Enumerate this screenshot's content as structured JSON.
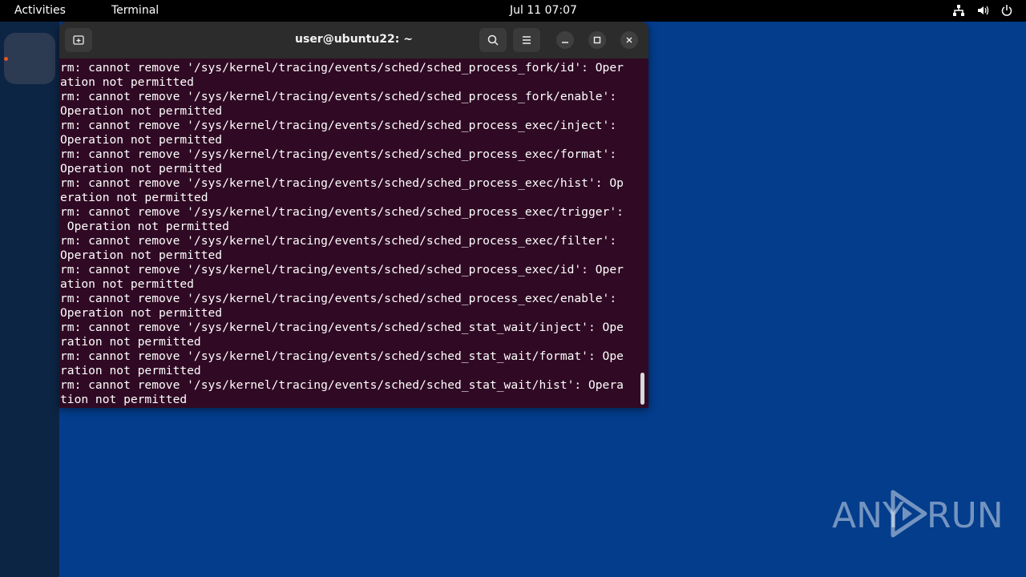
{
  "topbar": {
    "activities": "Activities",
    "app_name": "Terminal",
    "clock": "Jul 11  07:07",
    "tray_icons": [
      "network-icon",
      "volume-icon",
      "power-icon"
    ]
  },
  "dock": {
    "apps": [
      {
        "name": "terminal",
        "running": true
      }
    ],
    "running_indicator_color": "#e95420"
  },
  "window": {
    "title": "user@ubuntu22: ~",
    "background": "#300a24",
    "terminal_lines": [
      "rm: cannot remove '/sys/kernel/tracing/events/sched/sched_process_fork/id': Oper",
      "ation not permitted",
      "rm: cannot remove '/sys/kernel/tracing/events/sched/sched_process_fork/enable':",
      "Operation not permitted",
      "rm: cannot remove '/sys/kernel/tracing/events/sched/sched_process_exec/inject':",
      "Operation not permitted",
      "rm: cannot remove '/sys/kernel/tracing/events/sched/sched_process_exec/format':",
      "Operation not permitted",
      "rm: cannot remove '/sys/kernel/tracing/events/sched/sched_process_exec/hist': Op",
      "eration not permitted",
      "rm: cannot remove '/sys/kernel/tracing/events/sched/sched_process_exec/trigger':",
      " Operation not permitted",
      "rm: cannot remove '/sys/kernel/tracing/events/sched/sched_process_exec/filter':",
      "Operation not permitted",
      "rm: cannot remove '/sys/kernel/tracing/events/sched/sched_process_exec/id': Oper",
      "ation not permitted",
      "rm: cannot remove '/sys/kernel/tracing/events/sched/sched_process_exec/enable':",
      "Operation not permitted",
      "rm: cannot remove '/sys/kernel/tracing/events/sched/sched_stat_wait/inject': Ope",
      "ration not permitted",
      "rm: cannot remove '/sys/kernel/tracing/events/sched/sched_stat_wait/format': Ope",
      "ration not permitted",
      "rm: cannot remove '/sys/kernel/tracing/events/sched/sched_stat_wait/hist': Opera",
      "tion not permitted"
    ]
  },
  "desktop": {
    "background": "#033d8c",
    "watermark": {
      "left": "ANY",
      "right": "RUN"
    }
  }
}
